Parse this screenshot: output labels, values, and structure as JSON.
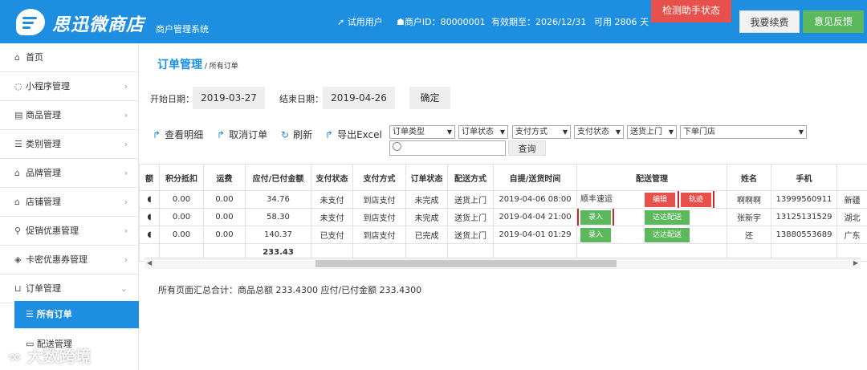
{
  "header": {
    "brand": "思迅微商店",
    "subtitle": "商户管理系统",
    "trial_user": "试用用户",
    "merchant_id": "商户ID：80000001",
    "expiry": "有效期至：2026/12/31",
    "days_left": "可用 2806 天",
    "detect_btn": "检测助手状态",
    "renew_btn": "我要续费",
    "feedback_btn": "意见反馈"
  },
  "sidebar": {
    "items": [
      {
        "icon": "home-icon",
        "glyph": "⌂",
        "label": "首页"
      },
      {
        "icon": "chat-icon",
        "glyph": "◌",
        "label": "小程序管理"
      },
      {
        "icon": "goods-icon",
        "glyph": "▤",
        "label": "商品管理"
      },
      {
        "icon": "list-icon",
        "glyph": "☰",
        "label": "类别管理"
      },
      {
        "icon": "bank-icon",
        "glyph": "⌂",
        "label": "品牌管理"
      },
      {
        "icon": "bank-icon",
        "glyph": "⌂",
        "label": "店铺管理"
      },
      {
        "icon": "pin-icon",
        "glyph": "⚲",
        "label": "促销优惠管理"
      },
      {
        "icon": "tag-icon",
        "glyph": "◈",
        "label": "卡密优惠券管理"
      },
      {
        "icon": "cart-icon",
        "glyph": "⊔",
        "label": "订单管理"
      }
    ],
    "sub_items": [
      {
        "icon": "list-icon",
        "label": "所有订单"
      },
      {
        "icon": "truck-icon",
        "label": "配送管理"
      }
    ],
    "watermark": "大数跨境"
  },
  "page": {
    "title": "订单管理",
    "crumb": " / 所有订单",
    "start_label": "开始日期：",
    "start_value": "2019-03-27",
    "end_label": "结束日期：",
    "end_value": "2019-04-26",
    "confirm": "确定"
  },
  "toolbar": {
    "view_detail": "查看明细",
    "cancel_order": "取消订单",
    "refresh": "刷新",
    "export": "导出Excel",
    "filters": [
      "订单类型",
      "订单状态",
      "支付方式",
      "支付状态",
      "送货上门",
      "下单门店"
    ],
    "search_placeholder": "",
    "search_btn": "查询"
  },
  "table": {
    "headers": [
      "额",
      "积分抵扣",
      "运费",
      "应付/已付金额",
      "支付状态",
      "支付方式",
      "订单状态",
      "配送方式",
      "自提/送货时间",
      "配送管理",
      "姓名",
      "手机",
      ""
    ],
    "rows": [
      {
        "points": "0.00",
        "freight": "0.00",
        "amount": "34.76",
        "pay_status": "未支付",
        "pay_method": "到店支付",
        "order_status": "未完成",
        "delivery": "送货上门",
        "time": "2019-04-06 08:00",
        "courier": "顺丰速运",
        "btn1": "编辑",
        "btn2": "轨迹",
        "name": "啊啊啊",
        "phone": "13999560911",
        "addr": "新疆"
      },
      {
        "points": "0.00",
        "freight": "0.00",
        "amount": "58.30",
        "pay_status": "未支付",
        "pay_method": "到店支付",
        "order_status": "未完成",
        "delivery": "送货上门",
        "time": "2019-04-04 21:00",
        "btn1": "录入",
        "btn2": "达达配送",
        "name": "张新宇",
        "phone": "13125131529",
        "addr": "湖北"
      },
      {
        "points": "0.00",
        "freight": "0.00",
        "amount": "140.37",
        "pay_status": "已支付",
        "pay_method": "到店支付",
        "order_status": "已完成",
        "delivery": "送货上门",
        "time": "2019-04-01 01:29",
        "btn1": "录入",
        "btn2": "达达配送",
        "name": "还",
        "phone": "13880553689",
        "addr": "广东"
      }
    ],
    "total": "233.43"
  },
  "summary": "所有页面汇总合计：商品总额 233.4300    应付/已付金额 233.4300",
  "colors": {
    "brand_blue": "#1e8ee0",
    "danger": "#e8504b",
    "success": "#5cb85c"
  }
}
